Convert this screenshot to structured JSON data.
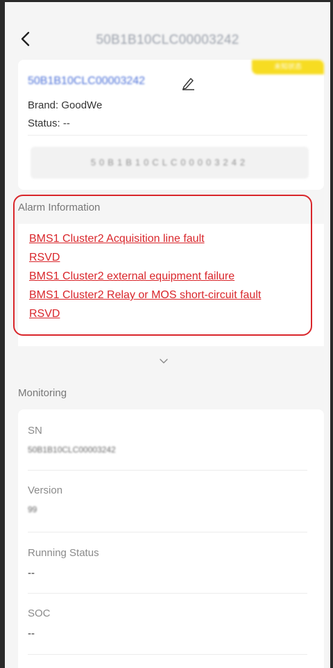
{
  "header": {
    "title": "50B1B10CLC00003242"
  },
  "device": {
    "badge": "未知状态",
    "sn_link": "50B1B10CLC00003242",
    "brand": "Brand: GoodWe",
    "status": "Status: --",
    "sn_box": "50B1B10CLC00003242"
  },
  "alarm": {
    "title": "Alarm Information",
    "items": [
      "BMS1 Cluster2 Acquisition line fault",
      "RSVD",
      "BMS1 Cluster2 external equipment failure",
      "BMS1 Cluster2 Relay or MOS short-circuit fault",
      "RSVD"
    ]
  },
  "monitoring": {
    "title": "Monitoring",
    "fields": [
      {
        "label": "SN",
        "value": "50B1B10CLC00003242"
      },
      {
        "label": "Version",
        "value": "99"
      },
      {
        "label": "Running Status",
        "value": "--"
      },
      {
        "label": "SOC",
        "value": "--"
      }
    ]
  },
  "colors": {
    "accent_red": "#d9262b",
    "link_blue": "#4a6fd8",
    "badge_yellow": "#f7dc22"
  }
}
